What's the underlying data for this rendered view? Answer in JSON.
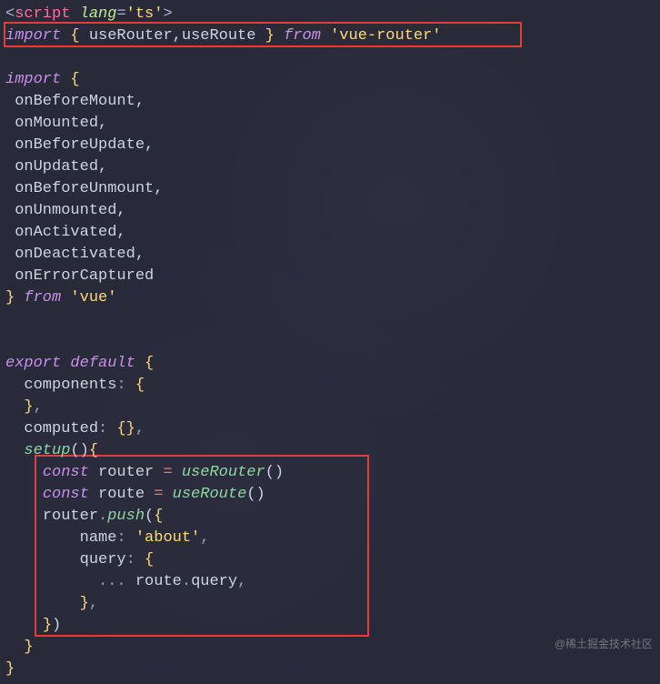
{
  "watermark": "@稀土掘金技术社区",
  "code": {
    "script_open": {
      "lt": "<",
      "tag": "script",
      "sp": " ",
      "attr": "lang",
      "eq": "=",
      "val": "'ts'",
      "gt": ">"
    },
    "l1": {
      "import": "import ",
      "ob": "{ ",
      "ids": "useRouter,useRoute",
      "cb": " }",
      "from": " from ",
      "mod": "'vue-router'"
    },
    "l_blank": "",
    "l3_import": "import ",
    "l3_brace": "{",
    "hooks": [
      "onBeforeMount,",
      "onMounted,",
      "onBeforeUpdate,",
      "onUpdated,",
      "onBeforeUnmount,",
      "onUnmounted,",
      "onActivated,",
      "onDeactivated,",
      "onErrorCaptured"
    ],
    "l_close_import_brace": "}",
    "l_close_import_from": " from ",
    "l_close_import_mod": "'vue'",
    "export": "export ",
    "default": "default ",
    "open_obj": "{",
    "components_key": "components",
    "colon": ": ",
    "empty_obj_open": "{",
    "empty_obj_close": "}",
    "comma": ",",
    "computed_key": "computed",
    "computed_empty": "{}",
    "setup": "setup",
    "setup_par": "()",
    "setup_body_open": "{",
    "c_router": "const ",
    "v_router": "router",
    "eq": " = ",
    "useRouter": "useRouter",
    "callpar": "()",
    "c_route": "const ",
    "v_route": "route",
    "useRoute": "useRoute",
    "push_obj": "router",
    "dot": ".",
    "push": "push",
    "open_call": "(",
    "open_obj2": "{",
    "name_key": "name",
    "name_val": "'about'",
    "query_key": "query",
    "query_open": "{",
    "spread": "... ",
    "route_ref": "route",
    "query_prop": "query",
    "q_close": "}",
    "obj2_close": "}",
    "call_close": ")",
    "setup_body_close": "}",
    "export_close": "}"
  }
}
